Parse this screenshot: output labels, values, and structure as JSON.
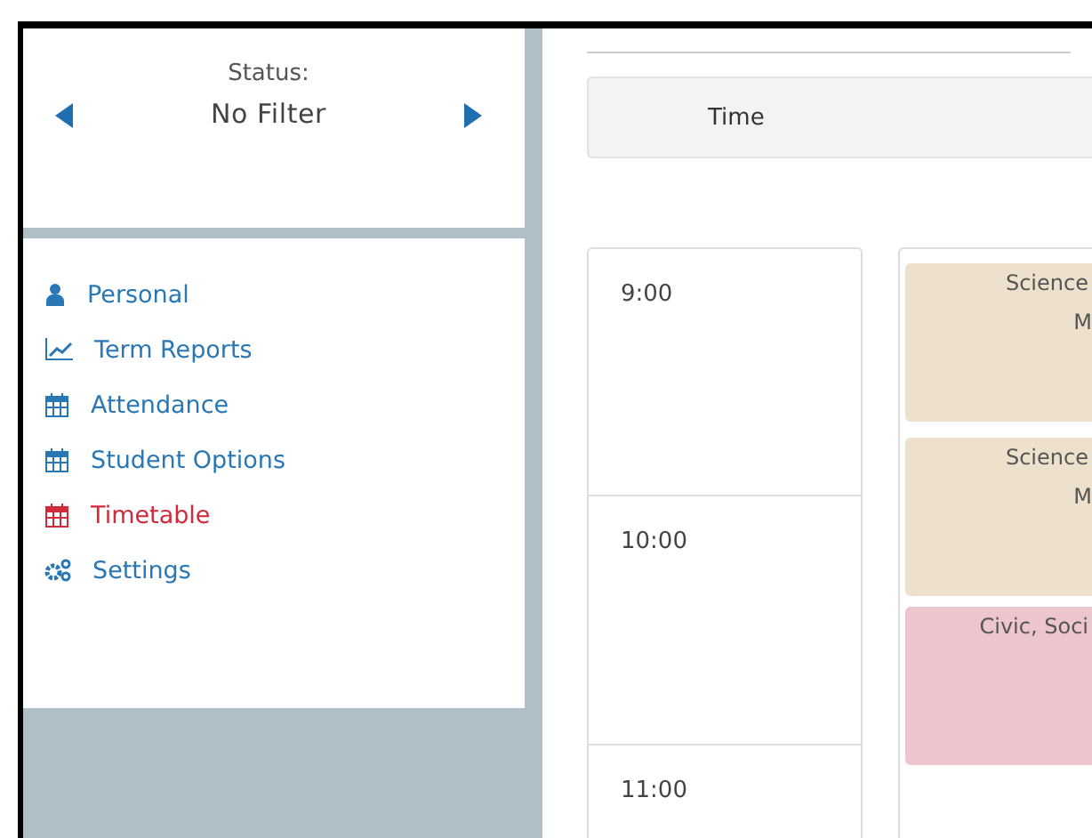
{
  "filter": {
    "label": "Status:",
    "value": "No Filter"
  },
  "nav": [
    {
      "label": "Personal",
      "selected": false
    },
    {
      "label": "Term Reports",
      "selected": false
    },
    {
      "label": "Attendance",
      "selected": false
    },
    {
      "label": "Student Options",
      "selected": false
    },
    {
      "label": "Timetable",
      "selected": true
    },
    {
      "label": "Settings",
      "selected": false
    }
  ],
  "timetable": {
    "header": "Time",
    "times": [
      "9:00",
      "10:00",
      "11:00"
    ],
    "events": [
      {
        "lines": [
          "Science",
          "M"
        ],
        "color": "#ede0cc"
      },
      {
        "lines": [
          "Science",
          "M"
        ],
        "color": "#ede0cc"
      },
      {
        "lines": [
          "Civic, Soci"
        ],
        "color": "#ecc6cc"
      }
    ]
  }
}
